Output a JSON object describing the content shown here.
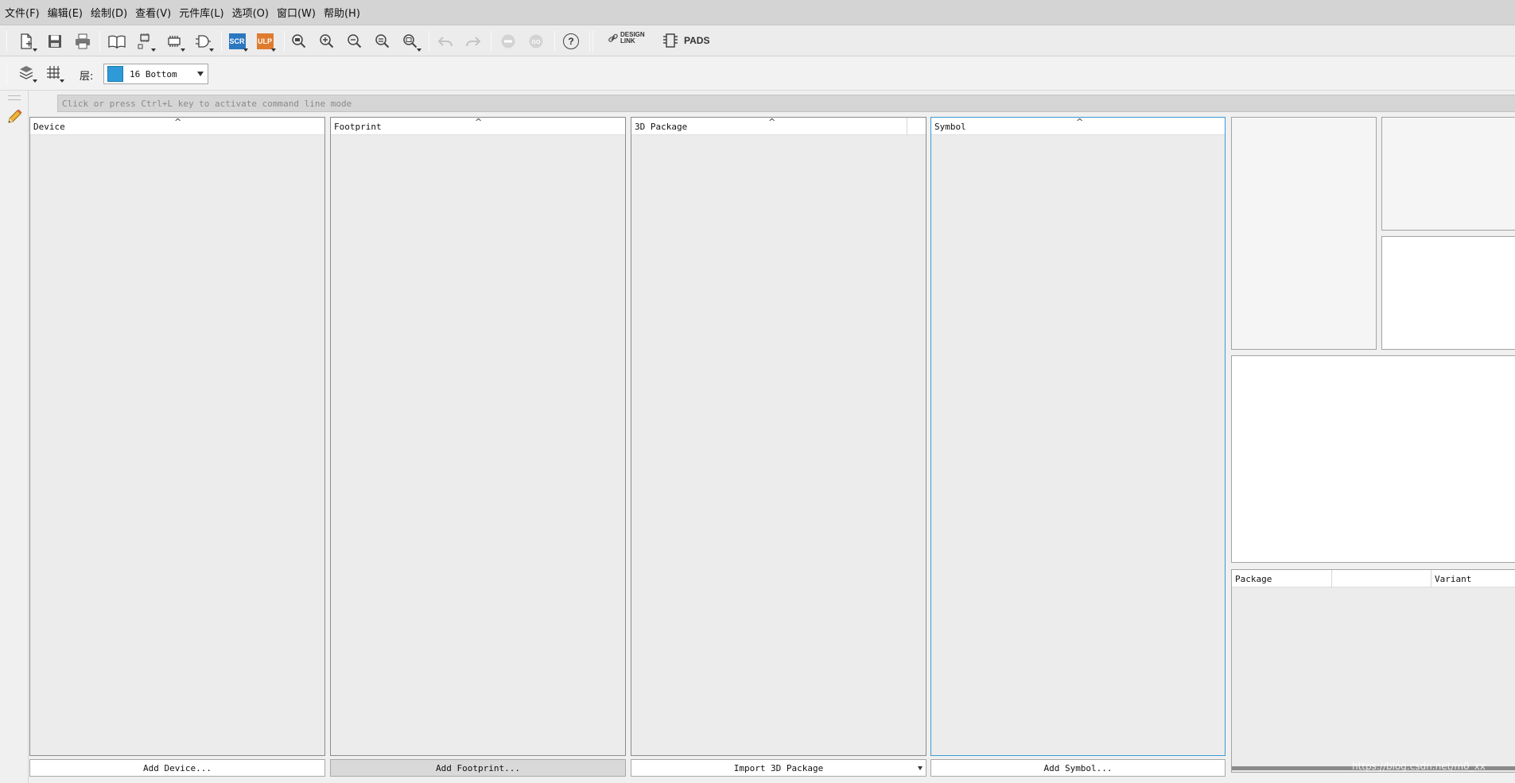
{
  "menu": [
    "文件(F)",
    "编辑(E)",
    "绘制(D)",
    "查看(V)",
    "元件库(L)",
    "选项(O)",
    "窗口(W)",
    "帮助(H)"
  ],
  "toolbar": {
    "icons": [
      "new-file-icon",
      "save-icon",
      "print-icon",
      "library-book-icon",
      "device-view-icon",
      "package-view-icon",
      "symbol-view-icon",
      "scr-script-icon",
      "ulp-icon",
      "zoom-fit-icon",
      "zoom-in-icon",
      "zoom-out-icon",
      "zoom-prev-icon",
      "zoom-select-icon",
      "undo-icon",
      "redo-icon",
      "stop-icon",
      "go-icon",
      "help-icon",
      "design-link-icon",
      "pads-icon"
    ],
    "scr_label": "SCR",
    "ulp_label": "ULP",
    "help_label": "?",
    "design_link_line1": "DESIGN",
    "design_link_line2": "LINK",
    "pads_label": "PADS"
  },
  "layerbar": {
    "label": "层:",
    "layer_value": "16 Bottom",
    "layer_color": "#2e9ad8"
  },
  "command_line": {
    "placeholder": "Click or press Ctrl+L key to activate command line mode"
  },
  "panels": {
    "device": {
      "title": "Device",
      "button": "Add Device..."
    },
    "footprint": {
      "title": "Footprint",
      "button": "Add Footprint..."
    },
    "package3d": {
      "title": "3D Package",
      "button": "Import 3D Package"
    },
    "symbol": {
      "title": "Symbol",
      "button": "Add Symbol..."
    }
  },
  "variant_table": {
    "columns": [
      "Package",
      "",
      "Variant"
    ]
  },
  "colors": {
    "accent": "#3a9bd5",
    "scr": "#2b77c0",
    "ulp": "#e07b2e"
  },
  "watermark": "https://blog.csdn.net/m0_xx"
}
